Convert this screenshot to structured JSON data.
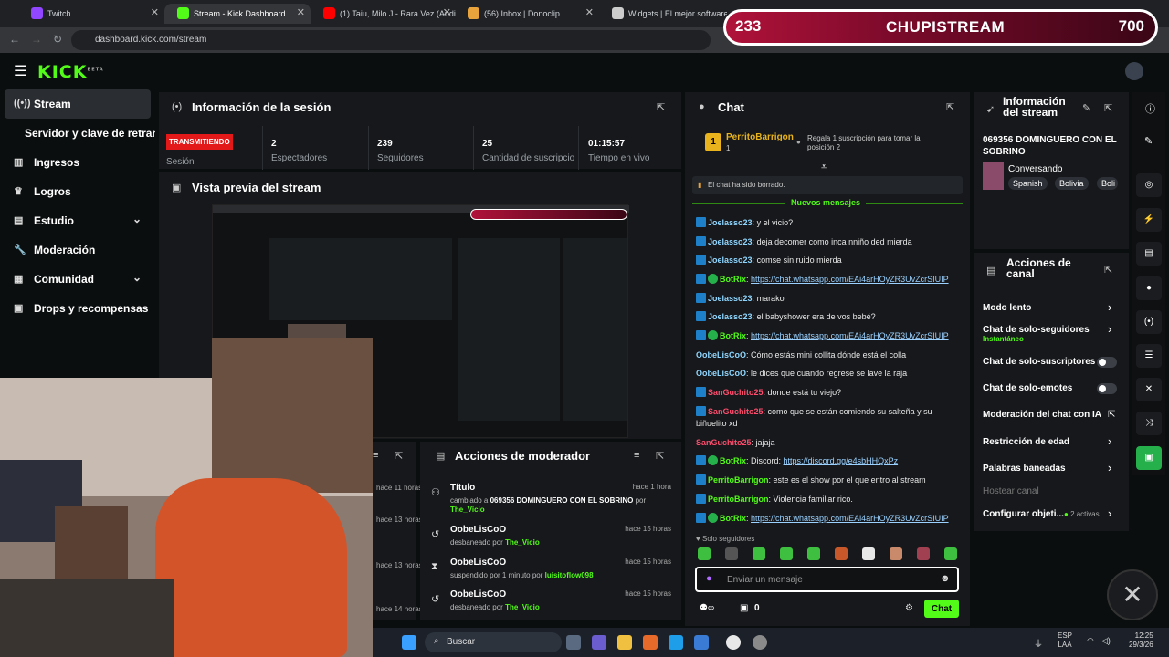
{
  "browser": {
    "tabs": [
      {
        "title": "Twitch",
        "color": "#9146ff"
      },
      {
        "title": "Stream - Kick Dashboard",
        "color": "#53fc18"
      },
      {
        "title": "(1) Taiu, Milo J - Rara Vez (Audi",
        "color": "#ff0000"
      },
      {
        "title": "(56) Inbox | Donoclip",
        "color": "#e8a33d"
      },
      {
        "title": "Widgets | El mejor software pa",
        "color": "#cccccc"
      }
    ],
    "url": "dashboard.kick.com/stream"
  },
  "overlay": {
    "left_num": "233",
    "name": "CHUPISTREAM",
    "right_num": "700"
  },
  "logo": "KICK",
  "logo_beta": "BETA",
  "sidebar": {
    "items": [
      {
        "label": "Stream",
        "icon": "broadcast-icon"
      },
      {
        "label": "Servidor y clave de retransmisión"
      },
      {
        "label": "Ingresos",
        "icon": "chart-icon"
      },
      {
        "label": "Logros",
        "icon": "trophy-icon"
      },
      {
        "label": "Estudio",
        "icon": "studio-icon"
      },
      {
        "label": "Moderación",
        "icon": "wrench-icon"
      },
      {
        "label": "Comunidad",
        "icon": "community-icon"
      },
      {
        "label": "Drops y recompensas",
        "icon": "gift-icon"
      }
    ]
  },
  "session": {
    "title": "Información de la sesión",
    "status": "TRANSMITIENDO",
    "status_label": "Sesión",
    "stats": [
      {
        "value": "2",
        "label": "Espectadores"
      },
      {
        "value": "239",
        "label": "Seguidores"
      },
      {
        "value": "25",
        "label": "Cantidad de suscripciones"
      },
      {
        "value": "01:15:57",
        "label": "Tiempo en vivo"
      }
    ]
  },
  "preview": {
    "title": "Vista previa del stream"
  },
  "left_partial_times": [
    "hace 11 horas",
    "hace 13 horas",
    "hace 13 horas",
    "hace 14 horas"
  ],
  "mod_actions": {
    "title": "Acciones de moderador",
    "rows": [
      {
        "name": "Título",
        "time": "hace 1 hora",
        "desc_prefix": "cambiado a",
        "desc_value": "069356 DOMINGUERO CON EL SOBRINO",
        "desc_by": "por",
        "user": "The_Vicio"
      },
      {
        "name": "OobeLisCoO",
        "time": "hace 15 horas",
        "desc_prefix": "desbaneado por",
        "user": "The_Vicio"
      },
      {
        "name": "OobeLisCoO",
        "time": "hace 15 horas",
        "desc_prefix": "suspendido por 1 minuto por",
        "user": "luisitoflow098"
      },
      {
        "name": "OobeLisCoO",
        "time": "hace 15 horas",
        "desc_prefix": "desbaneado por",
        "user": "The_Vicio"
      }
    ]
  },
  "chat": {
    "title": "Chat",
    "top_gifter": {
      "name": "PerritoBarrigon",
      "count": "1",
      "rank": "1"
    },
    "gift_prompt": "Regala 1 suscripción para tomar la posición 2",
    "deleted_notice": "El chat ha sido borrado.",
    "new_messages": "Nuevos mensajes",
    "messages": [
      {
        "user": "Joelasso23",
        "color": "#8fd6ff",
        "badge": "kick",
        "text": "y el vicio?"
      },
      {
        "user": "Joelasso23",
        "color": "#8fd6ff",
        "badge": "kick",
        "text": "deja decomer como inca nniño ded mierda"
      },
      {
        "user": "Joelasso23",
        "color": "#8fd6ff",
        "badge": "kick",
        "text": "comse sin ruido mierda"
      },
      {
        "user": "BotRix",
        "color": "#53fc18",
        "badge": "bot",
        "link": "https://chat.whatsapp.com/EAi4arHOyZR3UvZcrSIUIP"
      },
      {
        "user": "Joelasso23",
        "color": "#8fd6ff",
        "badge": "kick",
        "text": "marako"
      },
      {
        "user": "Joelasso23",
        "color": "#8fd6ff",
        "badge": "kick",
        "text": "el babyshower era de vos bebé?"
      },
      {
        "user": "BotRix",
        "color": "#53fc18",
        "badge": "bot",
        "link": "https://chat.whatsapp.com/EAi4arHOyZR3UvZcrSIUIP"
      },
      {
        "user": "OobeLisCoO",
        "color": "#8fd6ff",
        "badge": "",
        "text": "Cómo estás mini collita dónde está el colla"
      },
      {
        "user": "OobeLisCoO",
        "color": "#8fd6ff",
        "badge": "",
        "text": "le dices que cuando regrese se lave la raja"
      },
      {
        "user": "SanGuchito25",
        "color": "#ff4d6d",
        "badge": "kick",
        "text": "donde está tu viejo?"
      },
      {
        "user": "SanGuchito25",
        "color": "#ff4d6d",
        "badge": "kick",
        "text": "como que se están comiendo su salteña y su"
      },
      {
        "user": "",
        "color": "#fff",
        "badge": "",
        "text": "biñuelito xd"
      },
      {
        "user": "SanGuchito25",
        "color": "#ff4d6d",
        "badge": "",
        "text": "jajaja"
      },
      {
        "user": "BotRix",
        "color": "#53fc18",
        "badge": "bot",
        "prefix": "Discord:",
        "link": "https://discord.gg/e4sbHHQxPz"
      },
      {
        "user": "PerritoBarrigon",
        "color": "#53fc18",
        "badge": "kick",
        "text": "este es el show por el que entro al stream"
      },
      {
        "user": "PerritoBarrigon",
        "color": "#53fc18",
        "badge": "kick",
        "text": "Violencia familiar rico."
      },
      {
        "user": "BotRix",
        "color": "#53fc18",
        "badge": "bot",
        "link": "https://chat.whatsapp.com/EAi4arHOyZR3UvZcrSIUIP"
      }
    ],
    "followers_only": "Solo seguidores",
    "input_placeholder": "Enviar un mensaje",
    "points": "0",
    "send_label": "Chat"
  },
  "stream_info": {
    "title": "Información del stream",
    "stream_title": "069356 DOMINGUERO CON EL SOBRINO",
    "category": "Conversando",
    "tags": [
      "Spanish",
      "Bolivia",
      "Boli"
    ]
  },
  "channel_actions": {
    "title": "Acciones de canal",
    "items": [
      {
        "label": "Modo lento",
        "kind": "chevron"
      },
      {
        "label": "Chat de solo-seguidores",
        "sub": "Instantáneo",
        "kind": "chevron"
      },
      {
        "label": "Chat de solo-suscriptores",
        "kind": "toggle"
      },
      {
        "label": "Chat de solo-emotes",
        "kind": "toggle"
      },
      {
        "label": "Moderación del chat con IA",
        "kind": "external"
      },
      {
        "label": "Restricción de edad",
        "kind": "chevron"
      },
      {
        "label": "Palabras baneadas",
        "kind": "chevron"
      },
      {
        "label": "Hostear canal",
        "kind": "disabled"
      },
      {
        "label": "Configurar objeti...",
        "extra": "2 activas",
        "kind": "chevron"
      }
    ]
  },
  "taskbar": {
    "search": "Buscar",
    "lang1": "ESP",
    "lang2": "LAA",
    "time": "12:25",
    "date": "29/3/26"
  },
  "colors": {
    "kick_green": "#53fc18",
    "live_red": "#e31818",
    "panel": "#16181b",
    "bg": "#0b0e0f"
  }
}
